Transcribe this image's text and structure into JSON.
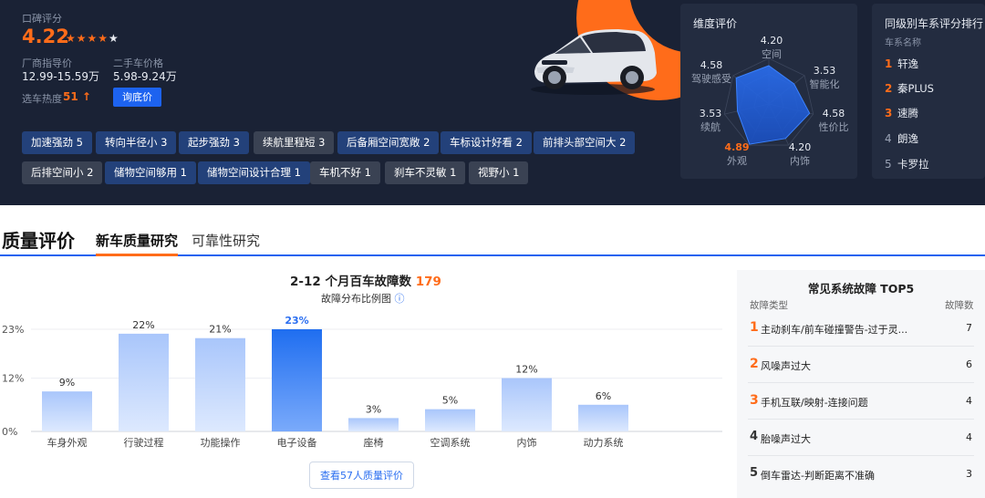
{
  "rating": {
    "label": "口碑评分",
    "score": "4.22",
    "stars": "★★★★★"
  },
  "prices": {
    "msrp_label": "厂商指导价",
    "msrp": "12.99-15.59万",
    "used_label": "二手车价格",
    "used": "5.98-9.24万",
    "heat_label": "选车热度",
    "heat": "51",
    "inquire_button": "询底价"
  },
  "tags_row1": [
    "加速强劲 5",
    "转向半径小 3",
    "起步强劲 3",
    "续航里程短 3",
    "后备厢空间宽敞 2",
    "车标设计好看 2",
    "前排头部空间大 2"
  ],
  "tags_row2": [
    "后排空间小 2",
    "储物空间够用 1",
    "储物空间设计合理 1",
    "车机不好 1",
    "刹车不灵敏 1",
    "视野小 1"
  ],
  "dimension": {
    "title": "维度评价",
    "items": [
      {
        "name": "空间",
        "score": "4.20"
      },
      {
        "name": "智能化",
        "score": "3.53"
      },
      {
        "name": "性价比",
        "score": "4.58"
      },
      {
        "name": "内饰",
        "score": "4.20"
      },
      {
        "name": "外观",
        "score": "4.89"
      },
      {
        "name": "续航",
        "score": "3.53"
      },
      {
        "name": "驾驶感受",
        "score": "4.58"
      }
    ],
    "radar_values": [
      4.2,
      3.53,
      4.58,
      4.2,
      4.89,
      3.53,
      4.58
    ],
    "highlight_color": "#ff6c1a"
  },
  "ranking": {
    "title": "同级别车系评分排行",
    "header": "车系名称",
    "items": [
      {
        "rank": "1",
        "name": "轩逸"
      },
      {
        "rank": "2",
        "name": "秦PLUS"
      },
      {
        "rank": "3",
        "name": "速腾"
      },
      {
        "rank": "4",
        "name": "朗逸"
      },
      {
        "rank": "5",
        "name": "卡罗拉"
      }
    ]
  },
  "quality": {
    "title": "质量评价",
    "tabs": [
      {
        "label": "新车质量研究"
      },
      {
        "label": "可靠性研究"
      }
    ]
  },
  "chart_data": {
    "type": "bar",
    "title": "2-12 个月百车故障数",
    "title_count": "179",
    "subtitle": "故障分布比例图",
    "categories": [
      "车身外观",
      "行驶过程",
      "功能操作",
      "电子设备",
      "座椅",
      "空调系统",
      "内饰",
      "动力系统"
    ],
    "values": [
      9,
      22,
      21,
      23,
      3,
      5,
      12,
      6
    ],
    "value_labels": [
      "9%",
      "22%",
      "21%",
      "23%",
      "3%",
      "5%",
      "12%",
      "6%"
    ],
    "highlight_index": 3,
    "yticks": [
      "23%",
      "12%",
      "0%"
    ],
    "ylim": [
      0,
      23
    ],
    "grid": true,
    "colors": {
      "normal_top": "#a9c6fb",
      "normal_bottom": "#dde9fe",
      "highlight_top": "#1f6ef0",
      "highlight_bottom": "#7aaafb"
    }
  },
  "view_more_button": "查看57人质量评价",
  "faults": {
    "title": "常见系统故障 TOP5",
    "col1": "故障类型",
    "col2": "故障数",
    "items": [
      {
        "rank": "1",
        "name": "主动刹车/前车碰撞警告-过于灵...",
        "count": "7"
      },
      {
        "rank": "2",
        "name": "风噪声过大",
        "count": "6"
      },
      {
        "rank": "3",
        "name": "手机互联/映射-连接问题",
        "count": "4"
      },
      {
        "rank": "4",
        "name": "胎噪声过大",
        "count": "4"
      },
      {
        "rank": "5",
        "name": "倒车雷达-判断距离不准确",
        "count": "3"
      }
    ]
  },
  "colors": {
    "accent": "#ff6c1a",
    "primary_blue": "#2a6ef0",
    "hero_bg": "#1a2235",
    "tag_positive": "#23417a",
    "tag_negative": "#3a4253"
  }
}
